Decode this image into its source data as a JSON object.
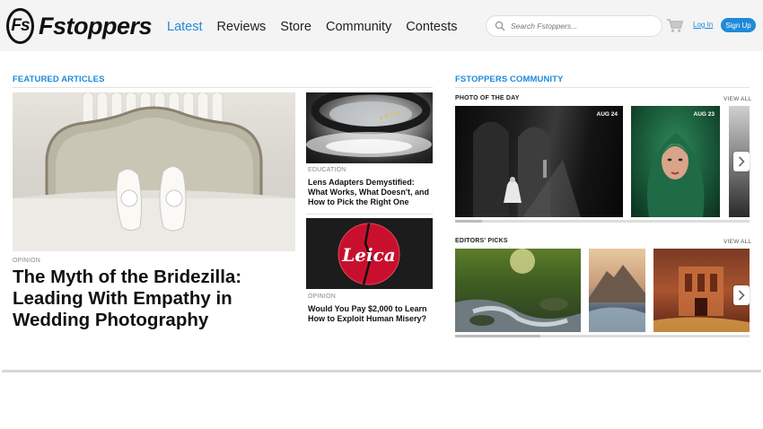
{
  "header": {
    "logo_mark": "Fs",
    "logo_text": "Fstoppers",
    "nav": [
      "Latest",
      "Reviews",
      "Store",
      "Community",
      "Contests"
    ],
    "search_placeholder": "Search Fstoppers...",
    "login": "Log In",
    "signup": "Sign Up"
  },
  "featured": {
    "title": "FEATURED ARTICLES",
    "main": {
      "category": "OPINION",
      "headline": "The Myth of the Bridezilla: Leading With Empathy in Wedding Photography"
    },
    "side": [
      {
        "category": "EDUCATION",
        "headline": "Lens Adapters Demystified: What Works, What Doesn't, and How to Pick the Right One"
      },
      {
        "category": "OPINION",
        "headline": "Would You Pay $2,000 to Learn How to Exploit Human Misery?",
        "image_text": "Leica"
      }
    ]
  },
  "community": {
    "title": "FSTOPPERS COMMUNITY",
    "photo_of_day": {
      "label": "PHOTO OF THE DAY",
      "view_all": "VIEW ALL",
      "dates": [
        "AUG 24",
        "AUG 23"
      ]
    },
    "editors_picks": {
      "label": "EDITORS' PICKS",
      "view_all": "VIEW ALL"
    }
  },
  "colors": {
    "accent": "#1f8ad8"
  }
}
